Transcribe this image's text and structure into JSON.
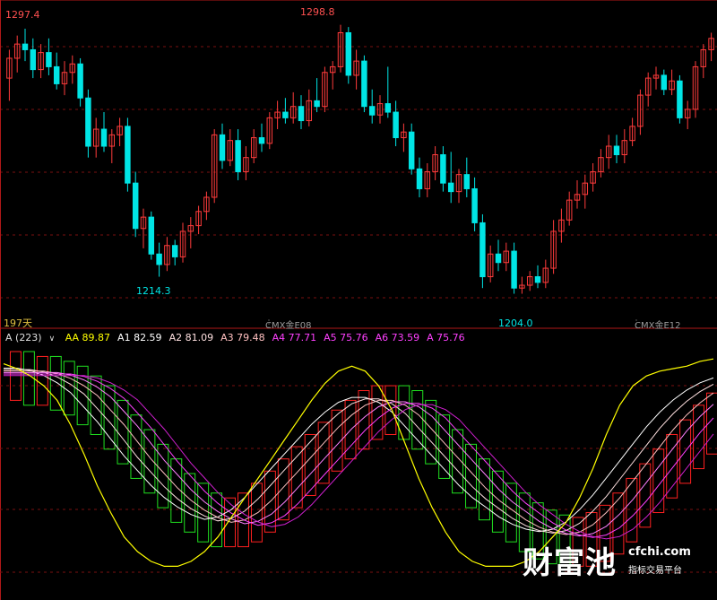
{
  "chart_data": [
    {
      "type": "candlestick",
      "title": "",
      "xlabel": "",
      "ylabel": "",
      "ylim": [
        1195,
        1305
      ],
      "grid": "horizontal dashed",
      "colors": {
        "up": "#ff3b3b",
        "down": "#00e5e5",
        "grid": "#7a1010"
      },
      "annotations": {
        "high_left": "1297.4",
        "high_mid": "1298.8",
        "low_left": "1214.3",
        "low_mid": "1204.0"
      },
      "ohlc": [
        [
          1280,
          1290,
          1272,
          1287
        ],
        [
          1287,
          1295,
          1282,
          1292
        ],
        [
          1292,
          1297.4,
          1286,
          1290
        ],
        [
          1290,
          1294,
          1280,
          1283
        ],
        [
          1283,
          1292,
          1280,
          1289
        ],
        [
          1289,
          1294,
          1281,
          1284
        ],
        [
          1284,
          1289,
          1276,
          1278
        ],
        [
          1278,
          1286,
          1274,
          1282
        ],
        [
          1282,
          1288,
          1278,
          1285
        ],
        [
          1285,
          1287,
          1270,
          1273
        ],
        [
          1273,
          1276,
          1252,
          1256
        ],
        [
          1256,
          1266,
          1252,
          1262
        ],
        [
          1262,
          1268,
          1254,
          1256
        ],
        [
          1256,
          1262,
          1250,
          1260
        ],
        [
          1260,
          1266,
          1256,
          1263
        ],
        [
          1263,
          1266,
          1240,
          1243
        ],
        [
          1243,
          1247,
          1224,
          1227
        ],
        [
          1227,
          1234,
          1220,
          1231
        ],
        [
          1231,
          1233,
          1216,
          1218
        ],
        [
          1218,
          1222,
          1210,
          1214.3
        ],
        [
          1214.3,
          1224,
          1212,
          1221
        ],
        [
          1221,
          1223,
          1214,
          1217
        ],
        [
          1217,
          1229,
          1215,
          1226
        ],
        [
          1226,
          1231,
          1220,
          1228
        ],
        [
          1228,
          1235,
          1225,
          1233
        ],
        [
          1233,
          1240,
          1230,
          1238
        ],
        [
          1238,
          1262,
          1236,
          1260
        ],
        [
          1260,
          1264,
          1248,
          1251
        ],
        [
          1251,
          1262,
          1249,
          1258
        ],
        [
          1258,
          1262,
          1244,
          1247
        ],
        [
          1247,
          1256,
          1244,
          1252
        ],
        [
          1252,
          1262,
          1250,
          1259
        ],
        [
          1259,
          1264,
          1254,
          1257
        ],
        [
          1257,
          1268,
          1255,
          1266
        ],
        [
          1266,
          1272,
          1262,
          1268
        ],
        [
          1268,
          1273,
          1264,
          1266
        ],
        [
          1266,
          1275,
          1264,
          1270
        ],
        [
          1270,
          1274,
          1262,
          1265
        ],
        [
          1265,
          1276,
          1263,
          1272
        ],
        [
          1272,
          1280,
          1268,
          1270
        ],
        [
          1270,
          1284,
          1268,
          1282
        ],
        [
          1282,
          1286,
          1276,
          1284
        ],
        [
          1284,
          1298.8,
          1282,
          1296
        ],
        [
          1296,
          1298,
          1278,
          1281
        ],
        [
          1281,
          1290,
          1276,
          1286
        ],
        [
          1286,
          1288,
          1268,
          1270
        ],
        [
          1270,
          1276,
          1264,
          1267
        ],
        [
          1267,
          1274,
          1264,
          1271
        ],
        [
          1271,
          1284,
          1266,
          1268
        ],
        [
          1268,
          1272,
          1256,
          1259
        ],
        [
          1259,
          1264,
          1254,
          1261
        ],
        [
          1261,
          1264,
          1246,
          1248
        ],
        [
          1248,
          1252,
          1238,
          1241
        ],
        [
          1241,
          1250,
          1238,
          1247
        ],
        [
          1247,
          1256,
          1244,
          1253
        ],
        [
          1253,
          1256,
          1240,
          1243
        ],
        [
          1243,
          1254,
          1236,
          1240
        ],
        [
          1240,
          1248,
          1236,
          1246
        ],
        [
          1246,
          1252,
          1238,
          1241
        ],
        [
          1241,
          1245,
          1226,
          1229
        ],
        [
          1229,
          1232,
          1206,
          1210
        ],
        [
          1210,
          1221,
          1208,
          1218
        ],
        [
          1218,
          1223,
          1212,
          1215
        ],
        [
          1215,
          1222,
          1212,
          1219
        ],
        [
          1219,
          1222,
          1204,
          1206
        ],
        [
          1206,
          1210,
          1204.0,
          1207
        ],
        [
          1207,
          1212,
          1205,
          1210
        ],
        [
          1210,
          1214,
          1206,
          1208
        ],
        [
          1208,
          1216,
          1206,
          1213
        ],
        [
          1213,
          1230,
          1211,
          1226
        ],
        [
          1226,
          1234,
          1222,
          1230
        ],
        [
          1230,
          1240,
          1228,
          1237
        ],
        [
          1237,
          1244,
          1234,
          1239
        ],
        [
          1239,
          1246,
          1234,
          1243
        ],
        [
          1243,
          1250,
          1240,
          1247
        ],
        [
          1247,
          1255,
          1245,
          1252
        ],
        [
          1252,
          1260,
          1248,
          1256
        ],
        [
          1256,
          1260,
          1250,
          1253
        ],
        [
          1253,
          1262,
          1250,
          1258
        ],
        [
          1258,
          1266,
          1256,
          1263
        ],
        [
          1263,
          1276,
          1260,
          1274
        ],
        [
          1274,
          1282,
          1270,
          1280
        ],
        [
          1280,
          1284,
          1276,
          1281
        ],
        [
          1281,
          1283,
          1274,
          1276
        ],
        [
          1276,
          1283,
          1274,
          1279
        ],
        [
          1279,
          1281,
          1264,
          1266
        ],
        [
          1266,
          1272,
          1262,
          1269
        ],
        [
          1269,
          1286,
          1266,
          1284
        ],
        [
          1284,
          1292,
          1280,
          1290
        ],
        [
          1290,
          1296,
          1286,
          1294
        ]
      ]
    },
    {
      "type": "indicator",
      "name": "A",
      "param": "(223)",
      "legend": [
        {
          "label": "AA",
          "value": "89.87",
          "color": "#ffff00"
        },
        {
          "label": "A1",
          "value": "82.59",
          "color": "#ffffff"
        },
        {
          "label": "A2",
          "value": "81.09",
          "color": "#ffe0e0"
        },
        {
          "label": "A3",
          "value": "79.48",
          "color": "#ffc0c0"
        },
        {
          "label": "A4",
          "value": "77.71",
          "color": "#ff40ff"
        },
        {
          "label": "A5",
          "value": "75.76",
          "color": "#ff40ff"
        },
        {
          "label": "A6",
          "value": "73.59",
          "color": "#ff40ff"
        },
        {
          "label": "A",
          "value": "75.76",
          "color": "#ff40ff"
        }
      ],
      "ylim": [
        0,
        100
      ],
      "aa_line": [
        95,
        93,
        90,
        86,
        80,
        70,
        58,
        45,
        34,
        24,
        18,
        14,
        12,
        12,
        14,
        18,
        24,
        32,
        40,
        48,
        56,
        64,
        72,
        80,
        87,
        92,
        94,
        92,
        86,
        76,
        62,
        48,
        36,
        26,
        18,
        14,
        12,
        12,
        12,
        14,
        18,
        24,
        30,
        40,
        52,
        66,
        78,
        86,
        90,
        92,
        93,
        94,
        96,
        97
      ],
      "a_line": [
        92,
        92,
        91,
        89,
        86,
        82,
        76,
        70,
        63,
        56,
        50,
        44,
        39,
        35,
        32,
        30,
        31,
        34,
        39,
        45,
        51,
        57,
        63,
        69,
        74,
        78,
        80,
        80,
        78,
        74,
        68,
        62,
        56,
        50,
        44,
        39,
        35,
        31,
        28,
        26,
        25,
        26,
        29,
        34,
        40,
        47,
        54,
        61,
        68,
        74,
        79,
        83,
        86,
        88
      ],
      "bars_hist": [
        94,
        94,
        92,
        92,
        90,
        88,
        84,
        80,
        74,
        68,
        62,
        56,
        50,
        44,
        40,
        36,
        34,
        34,
        36,
        40,
        45,
        50,
        55,
        60,
        65,
        70,
        74,
        78,
        80,
        80,
        78,
        74,
        68,
        62,
        56,
        50,
        45,
        40,
        36,
        32,
        29,
        27,
        26,
        26,
        28,
        31,
        36,
        42,
        48,
        54,
        60,
        66,
        72,
        77
      ]
    }
  ],
  "labels": {
    "days": "197天",
    "contract1": "CMX金E08",
    "contract2": "CMX金E12",
    "indicator_name": "A (223)"
  },
  "brand": {
    "name": "财富池",
    "domain": "cfchi.com",
    "tagline": "指标交易平台"
  }
}
